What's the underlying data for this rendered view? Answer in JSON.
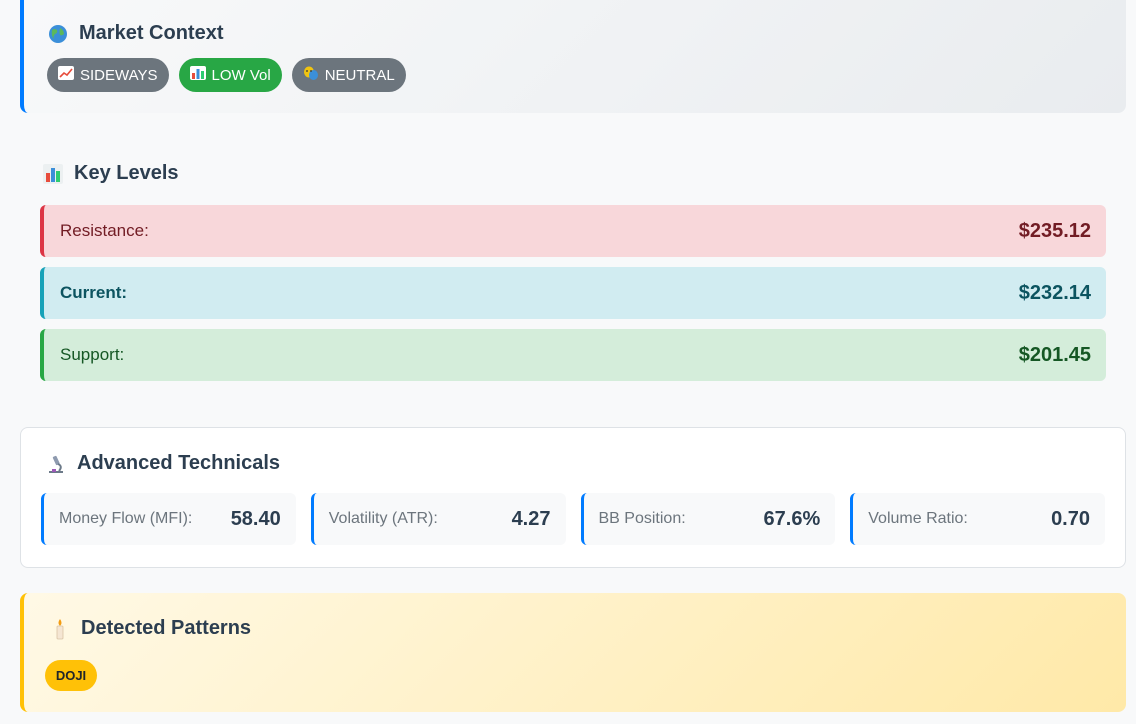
{
  "market_context": {
    "icon": "globe-icon",
    "title": "Market Context",
    "badges": [
      {
        "icon": "chart-increasing-icon",
        "label": "SIDEWAYS",
        "color": "#6c757d"
      },
      {
        "icon": "bar-chart-icon",
        "label": "LOW Vol",
        "color": "#28a745"
      },
      {
        "icon": "theater-masks-icon",
        "label": "NEUTRAL",
        "color": "#6c757d"
      }
    ]
  },
  "key_levels": {
    "icon": "bar-chart-icon",
    "title": "Key Levels",
    "rows": [
      {
        "label": "Resistance:",
        "value": "$235.12",
        "color": "#dc3545"
      },
      {
        "label": "Current:",
        "value": "$232.14",
        "color": "#17a2b8"
      },
      {
        "label": "Support:",
        "value": "$201.45",
        "color": "#28a745"
      }
    ]
  },
  "advanced_technicals": {
    "icon": "microscope-icon",
    "title": "Advanced Technicals",
    "metrics": [
      {
        "label": "Money Flow (MFI):",
        "value": "58.40"
      },
      {
        "label": "Volatility (ATR):",
        "value": "4.27"
      },
      {
        "label": "BB Position:",
        "value": "67.6%"
      },
      {
        "label": "Volume Ratio:",
        "value": "0.70"
      }
    ]
  },
  "detected_patterns": {
    "icon": "candle-icon",
    "title": "Detected Patterns",
    "patterns": [
      "DOJI"
    ],
    "accent": "#ffc107"
  }
}
